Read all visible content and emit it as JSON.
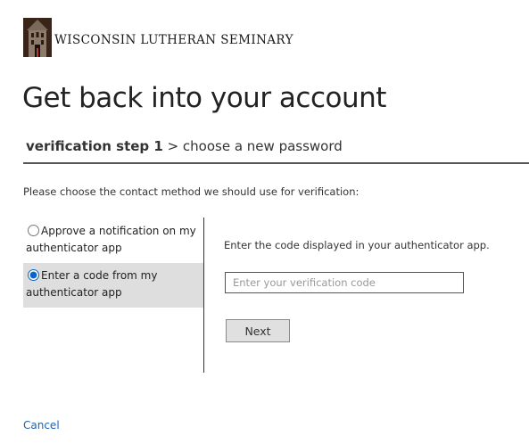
{
  "header": {
    "org_name": "WISCONSIN LUTHERAN SEMINARY",
    "logo_icon": "seminary-chapel-logo"
  },
  "page": {
    "title": "Get back into your account"
  },
  "steps": {
    "current": "verification step 1",
    "separator": " > ",
    "next": "choose a new password"
  },
  "verification": {
    "instruction": "Please choose the contact method we should use for verification:",
    "methods": [
      {
        "label": "Approve a notification on my authenticator app",
        "selected": false
      },
      {
        "label": "Enter a code from my authenticator app",
        "selected": true
      }
    ],
    "code_prompt": "Enter the code displayed in your authenticator app.",
    "code_value": "",
    "code_placeholder": "Enter your verification code",
    "next_label": "Next"
  },
  "footer": {
    "cancel_label": "Cancel"
  },
  "colors": {
    "link": "#1a64b4",
    "selected_bg": "#dedede",
    "logo_dark": "#3a2418"
  }
}
